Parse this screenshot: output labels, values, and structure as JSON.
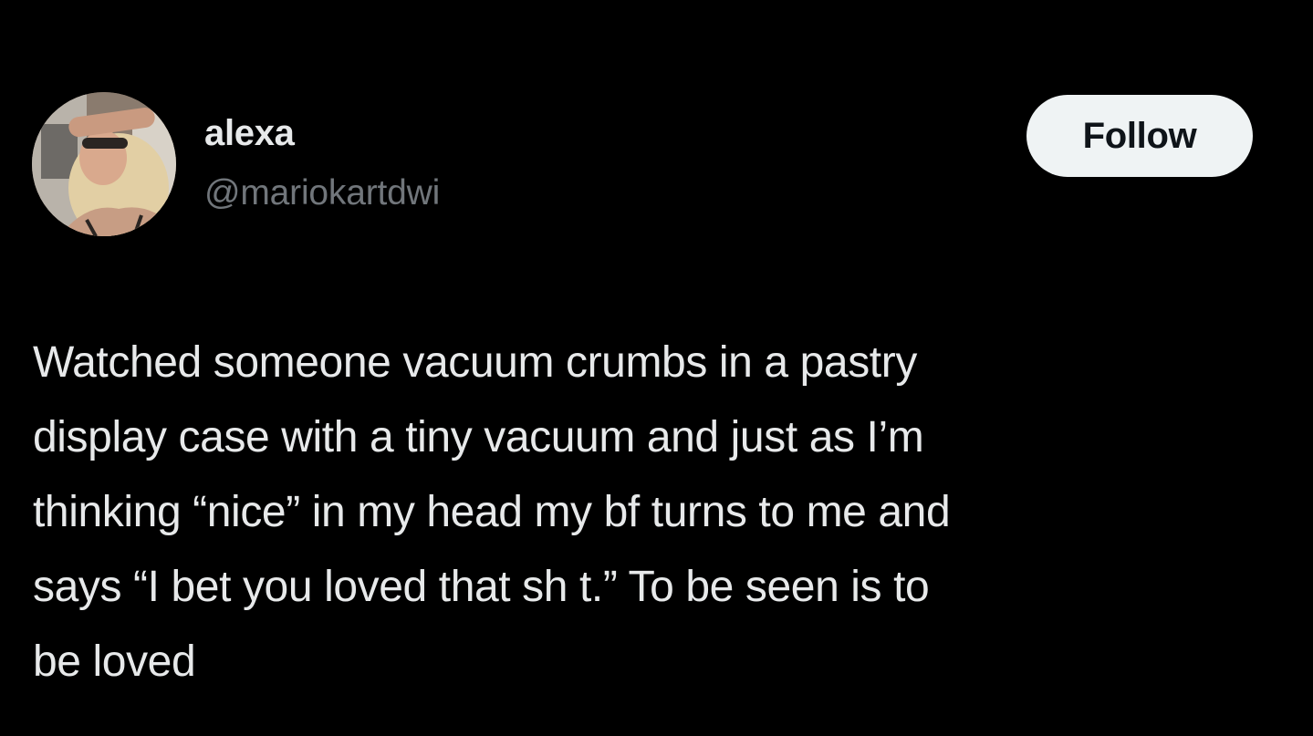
{
  "author": {
    "display_name": "alexa",
    "handle": "@mariokartdwi",
    "avatar_icon": "profile-photo"
  },
  "follow_button": {
    "label": "Follow"
  },
  "tweet": {
    "lines": [
      "Watched someone vacuum crumbs in a pastry",
      "display case with a tiny vacuum and just as I’m",
      "thinking “nice” in my head my bf turns to me and",
      "says “I bet you loved that sh t.” To be seen is to",
      "be loved"
    ]
  },
  "colors": {
    "background": "#000000",
    "primary_text": "#e7e9ea",
    "secondary_text": "#71767b",
    "button_bg": "#eff3f4",
    "button_text": "#0f1419"
  }
}
